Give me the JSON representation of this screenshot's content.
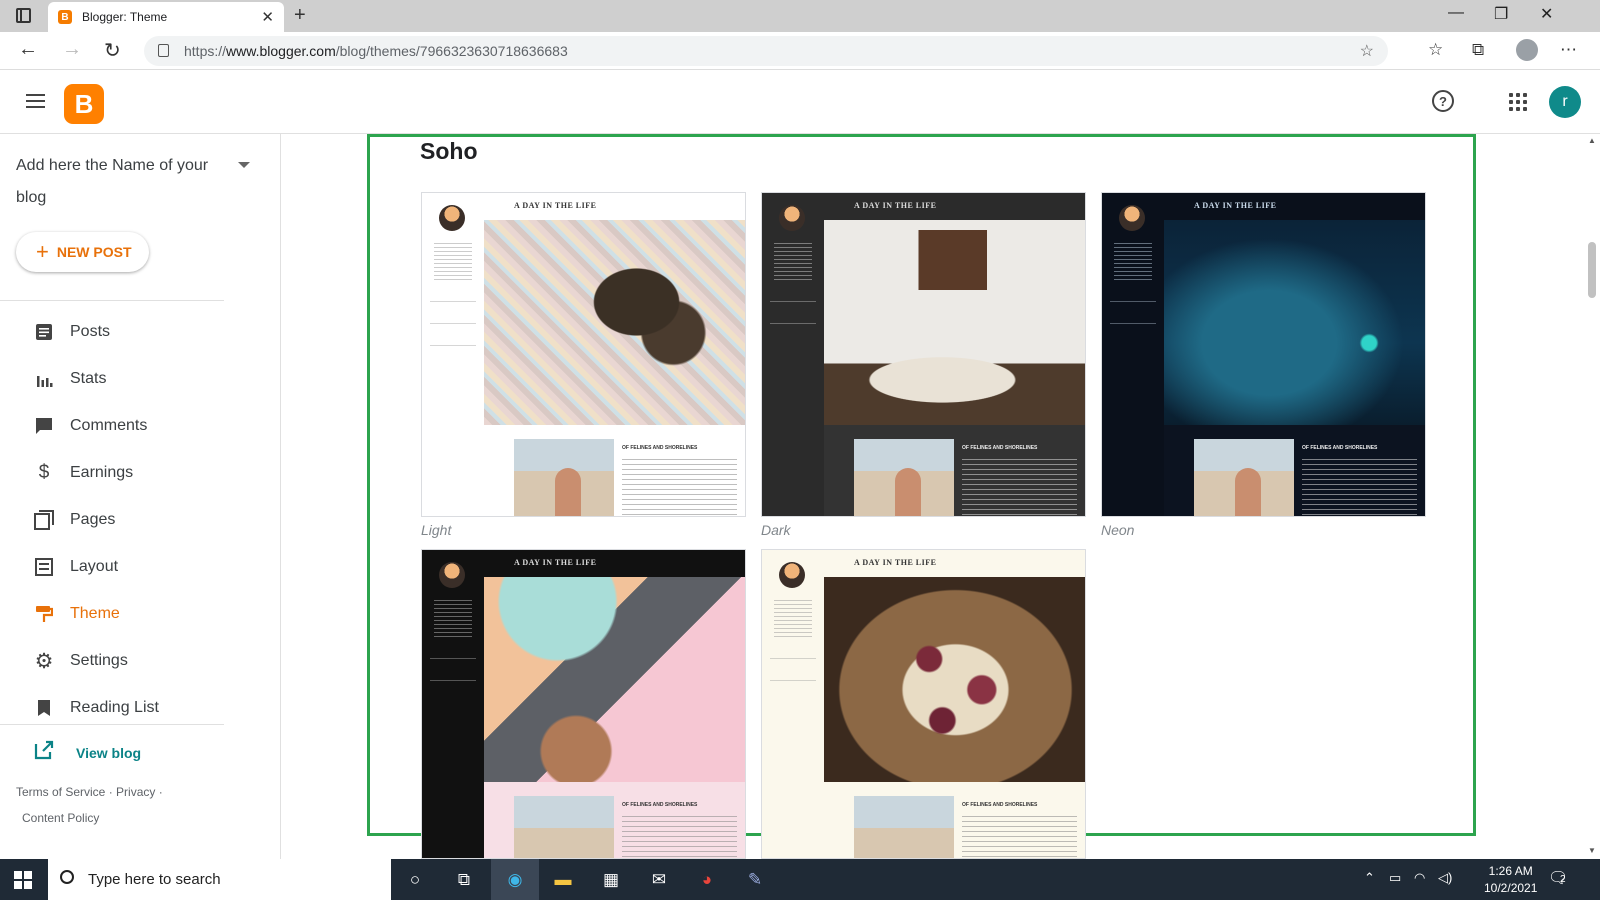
{
  "browser": {
    "tab_title": "Blogger: Theme",
    "url_prefix": "https://",
    "url_domain": "www.blogger.com",
    "url_path": "/blog/themes/7966323630718636683"
  },
  "app": {
    "avatar_letter": "r",
    "accent_color": "#e8710a"
  },
  "sidebar": {
    "blog_name": "Add here the Name of your blog",
    "new_post_label": "NEW POST",
    "items": [
      {
        "label": "Posts",
        "icon": "posts-icon"
      },
      {
        "label": "Stats",
        "icon": "stats-icon"
      },
      {
        "label": "Comments",
        "icon": "comments-icon"
      },
      {
        "label": "Earnings",
        "icon": "dollar-icon"
      },
      {
        "label": "Pages",
        "icon": "pages-icon"
      },
      {
        "label": "Layout",
        "icon": "layout-icon"
      },
      {
        "label": "Theme",
        "icon": "paint-roller-icon",
        "active": true
      },
      {
        "label": "Settings",
        "icon": "gear-icon"
      },
      {
        "label": "Reading List",
        "icon": "bookmark-icon"
      }
    ],
    "view_blog": "View blog",
    "footer": {
      "terms": "Terms of Service",
      "privacy": "Privacy",
      "content_policy": "Content Policy"
    }
  },
  "theme_section": {
    "title": "Soho",
    "variants": [
      {
        "label": "Light",
        "blog_title": "A DAY IN THE LIFE",
        "post_title": "OF FELINES AND SHORELINES"
      },
      {
        "label": "Dark",
        "blog_title": "A DAY IN THE LIFE",
        "post_title": "OF FELINES AND SHORELINES"
      },
      {
        "label": "Neon",
        "blog_title": "A DAY IN THE LIFE",
        "post_title": "OF FELINES AND SHORELINES"
      },
      {
        "label": "",
        "blog_title": "A DAY IN THE LIFE",
        "post_title": "OF FELINES AND SHORELINES"
      },
      {
        "label": "",
        "blog_title": "A DAY IN THE LIFE",
        "post_title": "OF FELINES AND SHORELINES"
      }
    ]
  },
  "taskbar": {
    "search_placeholder": "Type here to search",
    "time": "1:26 AM",
    "date": "10/2/2021",
    "notification_count": "2"
  }
}
